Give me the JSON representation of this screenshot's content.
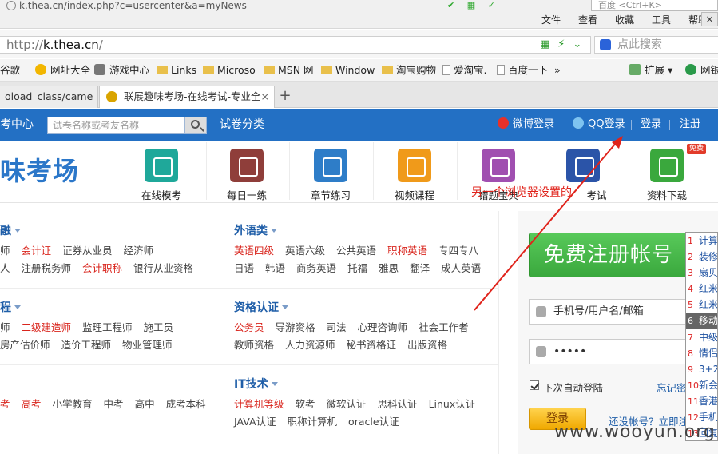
{
  "browser": {
    "top_url": "k.thea.cn/index.php?c=usercenter&a=myNews",
    "top_search_placeholder": "百度 <Ctrl+K>",
    "menus": [
      "文件",
      "查看",
      "收藏",
      "工具",
      "帮助"
    ],
    "address": {
      "prefix": "http://",
      "host": "k.thea.cn",
      "suffix": "/"
    },
    "search_placeholder": "点此搜索",
    "bookmarks": [
      "谷歌",
      "网址大全",
      "游戏中心",
      "Links",
      "Microso",
      "MSN 网",
      "Window",
      "淘宝购物",
      "爱淘宝.",
      "百度一下",
      "»",
      "扩展",
      "网银"
    ],
    "tabs": [
      {
        "label": "oload_class/came",
        "active": false
      },
      {
        "label": "联展趣味考场-在线考试-专业全",
        "active": true
      }
    ],
    "new_tab": "+",
    "close_label": "×"
  },
  "site": {
    "nav": {
      "left_title": "考中心",
      "search_placeholder": "试卷名称或考友名称",
      "category_link": "试卷分类",
      "weibo_login": "微博登录",
      "qq_login": "QQ登录",
      "login": "登录",
      "register": "注册"
    },
    "logo": "味考场",
    "features": [
      {
        "label": "在线模考",
        "color": "#1fa89a"
      },
      {
        "label": "每日一练",
        "color": "#8f3e3a"
      },
      {
        "label": "章节练习",
        "color": "#2e7dc8"
      },
      {
        "label": "视频课程",
        "color": "#f09a1a"
      },
      {
        "label": "错题宝典",
        "color": "#a04fb0"
      },
      {
        "label": "考试",
        "color": "#2b54a8"
      },
      {
        "label": "资料下载",
        "color": "#3aa83d"
      }
    ],
    "free_badge": "免费",
    "overlay_text": "另一个浏览器设置的",
    "categories": {
      "left1": {
        "title": "融",
        "rows": [
          [
            {
              "t": "师",
              "red": false
            },
            {
              "t": "会计证",
              "red": true
            },
            {
              "t": "证券从业员",
              "red": false
            },
            {
              "t": "经济师",
              "red": false
            }
          ],
          [
            {
              "t": "人",
              "red": false
            },
            {
              "t": "注册税务师",
              "red": false
            },
            {
              "t": "会计职称",
              "red": true
            },
            {
              "t": "银行从业资格",
              "red": false
            }
          ]
        ]
      },
      "left2": {
        "title": "程",
        "rows": [
          [
            {
              "t": "师",
              "red": false
            },
            {
              "t": "二级建造师",
              "red": true
            },
            {
              "t": "监理工程师",
              "red": false
            },
            {
              "t": "施工员",
              "red": false
            }
          ],
          [
            {
              "t": "房产估价师",
              "red": false
            },
            {
              "t": "造价工程师",
              "red": false
            },
            {
              "t": "物业管理师",
              "red": false
            }
          ]
        ]
      },
      "left3": {
        "title": "",
        "rows": [
          [
            {
              "t": "考",
              "red": true
            },
            {
              "t": "高考",
              "red": true
            },
            {
              "t": "小学教育",
              "red": false
            },
            {
              "t": "中考",
              "red": false
            },
            {
              "t": "高中",
              "red": false
            },
            {
              "t": "成考本科",
              "red": false
            }
          ]
        ]
      },
      "right1": {
        "title": "外语类",
        "rows": [
          [
            {
              "t": "英语四级",
              "red": true
            },
            {
              "t": "英语六级",
              "red": false
            },
            {
              "t": "公共英语",
              "red": false
            },
            {
              "t": "职称英语",
              "red": true
            },
            {
              "t": "专四专八",
              "red": false
            }
          ],
          [
            {
              "t": "日语",
              "red": false
            },
            {
              "t": "韩语",
              "red": false
            },
            {
              "t": "商务英语",
              "red": false
            },
            {
              "t": "托福",
              "red": false
            },
            {
              "t": "雅思",
              "red": false
            },
            {
              "t": "翻译",
              "red": false
            },
            {
              "t": "成人英语",
              "red": false
            }
          ]
        ]
      },
      "right2": {
        "title": "资格认证",
        "rows": [
          [
            {
              "t": "公务员",
              "red": true
            },
            {
              "t": "导游资格",
              "red": false
            },
            {
              "t": "司法",
              "red": false
            },
            {
              "t": "心理咨询师",
              "red": false
            },
            {
              "t": "社会工作者",
              "red": false
            }
          ],
          [
            {
              "t": "教师资格",
              "red": false
            },
            {
              "t": "人力资源师",
              "red": false
            },
            {
              "t": "秘书资格证",
              "red": false
            },
            {
              "t": "出版资格",
              "red": false
            }
          ]
        ]
      },
      "right3": {
        "title": "IT技术",
        "rows": [
          [
            {
              "t": "计算机等级",
              "red": true
            },
            {
              "t": "软考",
              "red": false
            },
            {
              "t": "微软认证",
              "red": false
            },
            {
              "t": "思科认证",
              "red": false
            },
            {
              "t": "Linux认证",
              "red": false
            }
          ],
          [
            {
              "t": "JAVA认证",
              "red": false
            },
            {
              "t": "职称计算机",
              "red": false
            },
            {
              "t": "oracle认证",
              "red": false
            }
          ]
        ]
      }
    },
    "login_panel": {
      "register_button": "免费注册帐号",
      "username_placeholder": "手机号/用户名/邮箱",
      "password_mask": "•••••",
      "remember": "下次自动登陆",
      "forgot": "忘记密",
      "login_button": "登录",
      "no_account": "还没帐号？立即注"
    },
    "dropdown": [
      {
        "n": "1",
        "t": "计算"
      },
      {
        "n": "2",
        "t": "装修"
      },
      {
        "n": "3",
        "t": "扇贝"
      },
      {
        "n": "4",
        "t": "红米"
      },
      {
        "n": "5",
        "t": "红米"
      },
      {
        "n": "6",
        "t": "移动"
      },
      {
        "n": "7",
        "t": "中级"
      },
      {
        "n": "8",
        "t": "情侣"
      },
      {
        "n": "9",
        "t": "3+2"
      },
      {
        "n": "10",
        "t": "新会"
      },
      {
        "n": "11",
        "t": "香港"
      },
      {
        "n": "12",
        "t": "手机"
      },
      {
        "n": "13",
        "t": "回复"
      }
    ],
    "dropdown_selected": 5
  },
  "watermark": "www.wooyun.org",
  "colors": {
    "nav_blue": "#2370c4",
    "accent_red": "#d9251d",
    "register_green": "#3aa83d",
    "login_yellow": "#f0a800"
  }
}
